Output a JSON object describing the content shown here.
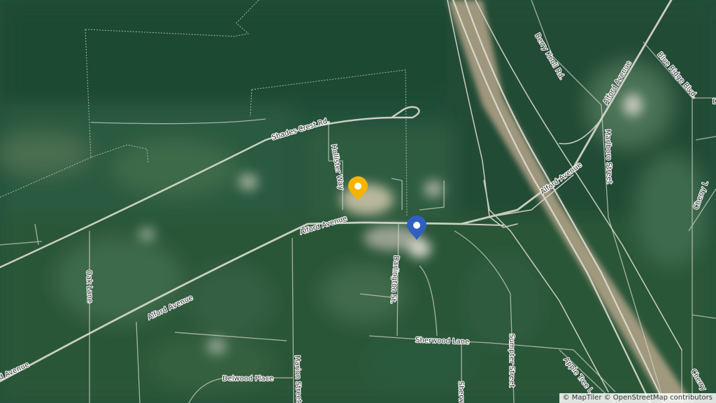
{
  "map": {
    "attribution": "© MapTiler © OpenStreetMap contributors",
    "pin_colors": {
      "orange": "#f5b400",
      "blue": "#2f5fbf"
    },
    "street_labels": {
      "shades_crest": "Shades Crest Rd.",
      "hollister": "Hollister Way",
      "alford_main": "Alford Avenue",
      "alford_sw": "Alford Avenue",
      "alford_edge": "d Avenue",
      "alford_ne1": "Alford Avenue",
      "alford_ne2": "Alford Avenue",
      "berry_knoll": "Berry Knoll Rd.",
      "blue_ridge": "Blue Ridge Blvd.",
      "marlboro": "Marlboro Street",
      "cherry_l": "Cherry L",
      "cherry_edge": "Cherry",
      "oak": "Oak Lane",
      "darlington": "Darlington St.",
      "sherwood_lane": "Sherwood Lane",
      "sherwood_edge": "Sherw",
      "sumpter": "Sumpter Street",
      "apple_tree": "Apple Tree L",
      "delwood": "Delwood Place",
      "marion": "Marion Street",
      "edge_d": "D"
    }
  }
}
